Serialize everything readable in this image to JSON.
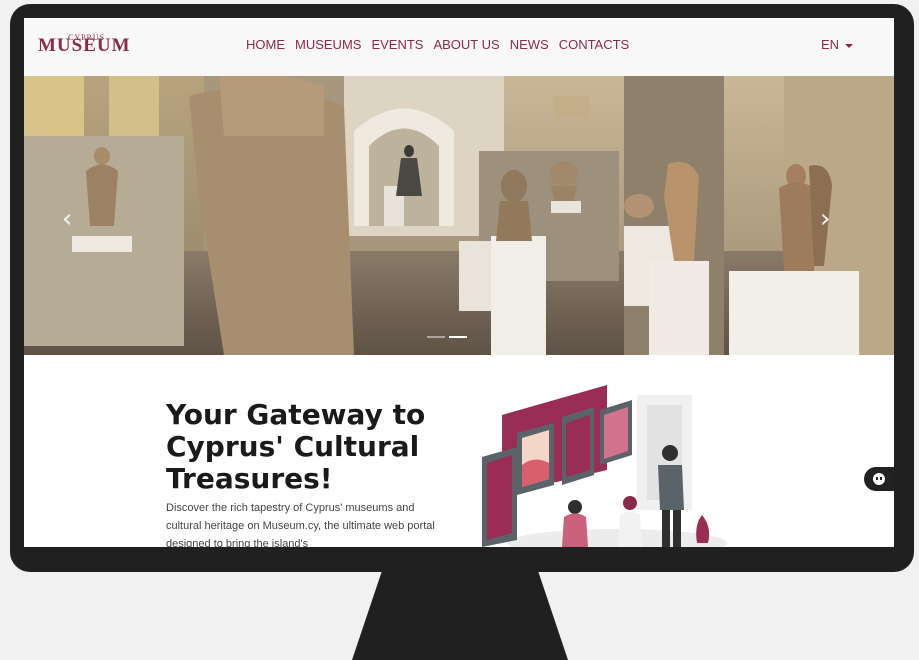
{
  "brand": {
    "logo_small": "CYPRUS",
    "logo_main": "MUSEUM",
    "color": "#8a2a4a"
  },
  "nav": {
    "items": [
      "HOME",
      "MUSEUMS",
      "EVENTS",
      "ABOUT US",
      "NEWS",
      "CONTACTS"
    ]
  },
  "language": {
    "label": "EN"
  },
  "carousel": {
    "prev_icon": "‹",
    "next_icon": "›",
    "slide_count": 2,
    "active_slide": 2
  },
  "hero_text": {
    "headline": "Your Gateway to Cyprus' Cultural Treasures!",
    "intro": "Discover the rich tapestry of Cyprus' museums and cultural heritage on Museum.cy, the ultimate web portal designed to bring the island's"
  },
  "chat_widget": {
    "icon": "chat-bot-icon"
  }
}
